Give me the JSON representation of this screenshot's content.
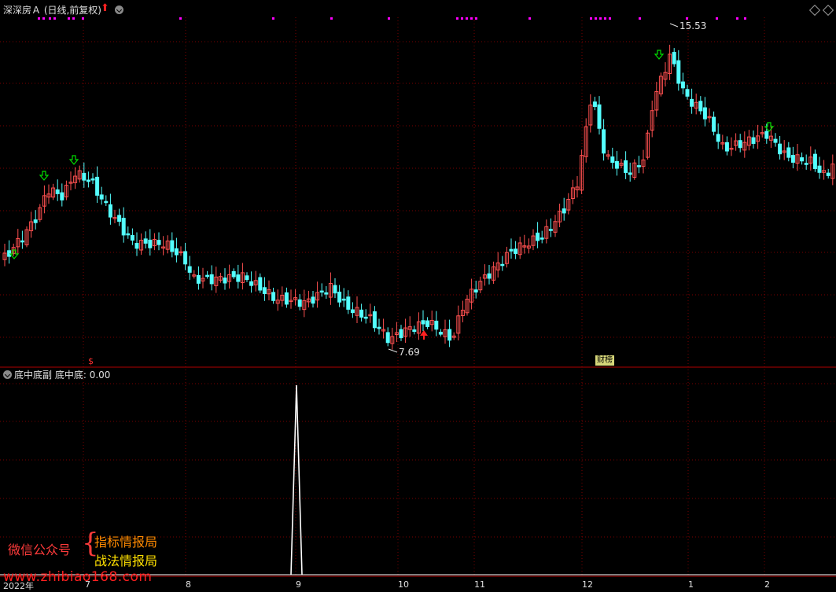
{
  "header": {
    "title": "深深房Ａ (日线,前复权)",
    "menu_icon": "chevron-down-icon",
    "up_arrow_icon": "red-up-arrow-icon"
  },
  "window_controls": {
    "restore_icon": "diamond-icon",
    "close_icon": "diamond-icon"
  },
  "price_panel": {
    "high_label": "15.53",
    "low_label": "7.69",
    "badge": "财榜",
    "s_mark": "$",
    "colors": {
      "up": "#ff5050",
      "down": "#54ffff",
      "grid": "#7a0000",
      "signal": "#ff00ff",
      "arrow": "#00dd00",
      "label": "#e0e0e0"
    }
  },
  "indicator_panel": {
    "title": "底中底副",
    "value_label": "底中底: 0.00"
  },
  "promo": {
    "wechat": "微信公众号",
    "brace": "{",
    "line1": "指标情报局",
    "line2": "战法情报局",
    "watermark": "www.zhibiao168.com"
  },
  "x_axis": {
    "ticks": [
      "2022年",
      "7",
      "8",
      "9",
      "10",
      "11",
      "12",
      "1",
      "2"
    ]
  }
}
